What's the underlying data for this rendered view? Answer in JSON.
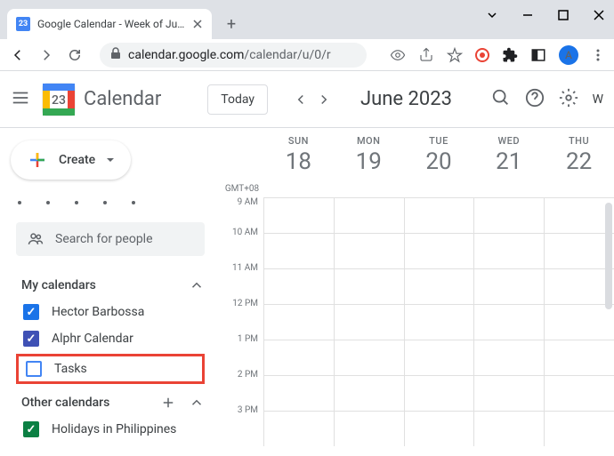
{
  "browser": {
    "tab_title": "Google Calendar - Week of June",
    "url_host": "calendar.google.com",
    "url_path": "/calendar/u/0/r",
    "avatar_letter": "A"
  },
  "header": {
    "app_name": "Calendar",
    "logo_day": "23",
    "today_label": "Today",
    "month_label": "June 2023",
    "view_initial": "W"
  },
  "sidebar": {
    "create_label": "Create",
    "search_placeholder": "Search for people",
    "my_calendars_label": "My calendars",
    "other_calendars_label": "Other calendars",
    "calendars": [
      {
        "label": "Hector Barbossa",
        "color": "#1a73e8",
        "checked": true
      },
      {
        "label": "Alphr Calendar",
        "color": "#3f51b5",
        "checked": true
      },
      {
        "label": "Tasks",
        "color": "#4285f4",
        "checked": false
      }
    ],
    "other_calendars": [
      {
        "label": "Holidays in Philippines",
        "color": "#0b8043",
        "checked": true
      }
    ]
  },
  "grid": {
    "timezone": "GMT+08",
    "days": [
      {
        "abbr": "SUN",
        "num": "18"
      },
      {
        "abbr": "MON",
        "num": "19"
      },
      {
        "abbr": "TUE",
        "num": "20"
      },
      {
        "abbr": "WED",
        "num": "21"
      },
      {
        "abbr": "THU",
        "num": "22"
      }
    ],
    "times": [
      "9 AM",
      "10 AM",
      "11 AM",
      "12 PM",
      "1 PM",
      "2 PM",
      "3 PM"
    ]
  }
}
